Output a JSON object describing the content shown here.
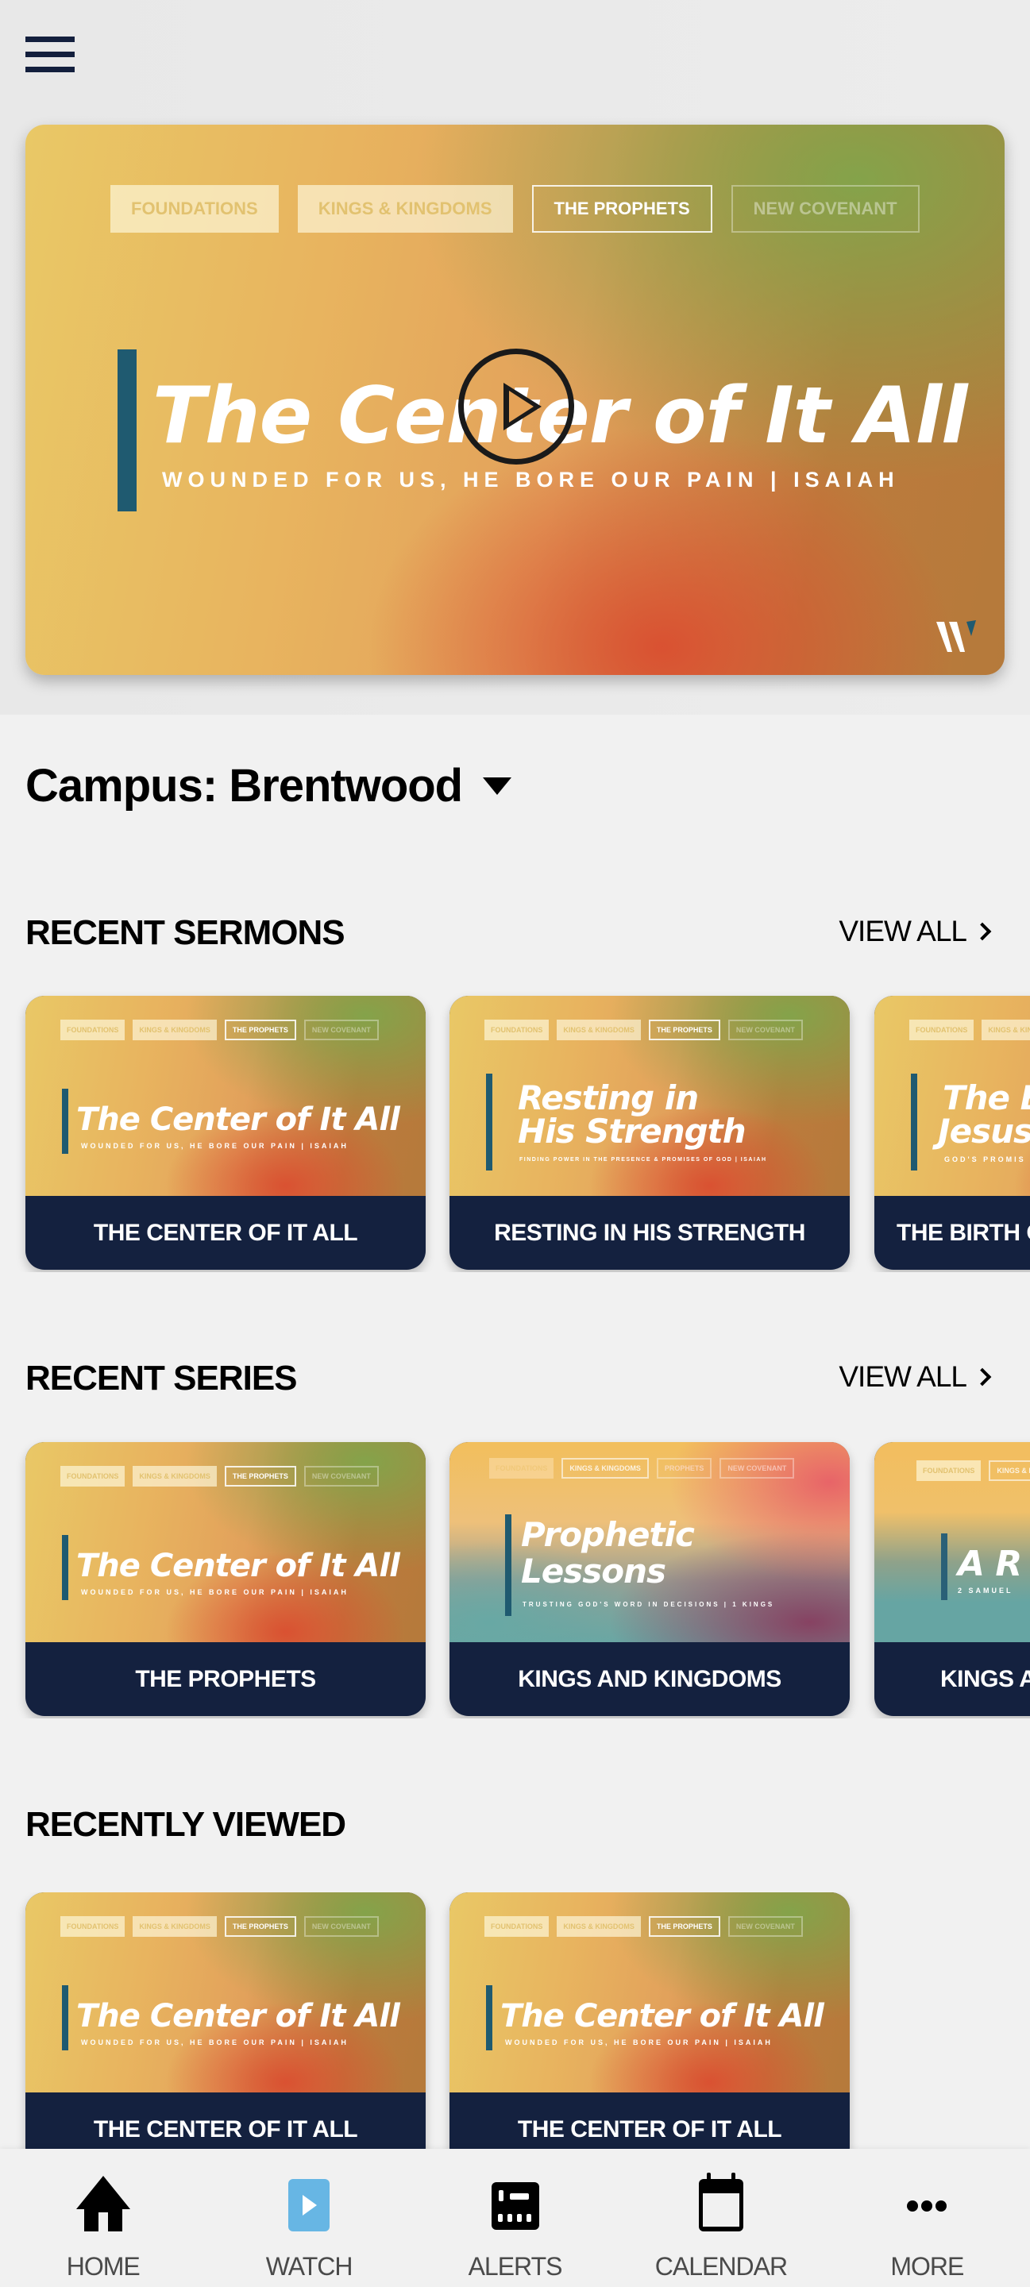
{
  "header": {
    "menu_icon": "hamburger-menu-icon"
  },
  "hero": {
    "tags": [
      "FOUNDATIONS",
      "KINGS & KINGDOMS",
      "THE PROPHETS",
      "NEW COVENANT"
    ],
    "title": "The Center of It All",
    "subtitle": "WOUNDED FOR US, HE BORE OUR PAIN | ISAIAH",
    "play_icon": "play-circle-icon",
    "logo": "W"
  },
  "campus": {
    "label": "Campus: Brentwood"
  },
  "sections": {
    "recent_sermons": {
      "title": "RECENT SERMONS",
      "view_all": "VIEW ALL",
      "items": [
        {
          "art_title": "The Center of It All",
          "art_sub": "WOUNDED FOR US, HE BORE OUR PAIN | ISAIAH",
          "caption": "THE CENTER OF IT ALL"
        },
        {
          "art_title_1": "Resting in",
          "art_title_2": "His Strength",
          "art_sub": "FINDING POWER IN THE PRESENCE & PROMISES OF GOD | ISAIAH",
          "caption": "RESTING IN HIS STRENGTH"
        },
        {
          "art_title_1": "The B",
          "art_title_2": "Jesus",
          "art_sub": "GOD'S PROMIS",
          "caption": "THE BIRTH O"
        }
      ]
    },
    "recent_series": {
      "title": "RECENT SERIES",
      "view_all": "VIEW ALL",
      "items": [
        {
          "art_title": "The Center of It All",
          "art_sub": "WOUNDED FOR US, HE BORE OUR PAIN | ISAIAH",
          "caption": "THE PROPHETS"
        },
        {
          "art_title_1": "Prophetic",
          "art_title_2": "Lessons",
          "art_sub": "TRUSTING GOD'S WORD IN DECISIONS | 1 KINGS",
          "caption": "KINGS AND KINGDOMS",
          "tags": [
            "FOUNDATIONS",
            "KINGS & KINGDOMS",
            "PROPHETS",
            "NEW COVENANT"
          ]
        },
        {
          "art_title": "A R",
          "art_sub": "2 SAMUEL",
          "caption": "KINGS A"
        }
      ]
    },
    "recently_viewed": {
      "title": "RECENTLY VIEWED",
      "items": [
        {
          "art_title": "The Center of It All",
          "art_sub": "WOUNDED FOR US, HE BORE OUR PAIN | ISAIAH",
          "caption": "THE CENTER OF IT ALL"
        },
        {
          "art_title": "The Center of It All",
          "art_sub": "WOUNDED FOR US, HE BORE OUR PAIN | ISAIAH",
          "caption": "THE CENTER OF IT ALL"
        }
      ]
    }
  },
  "card_tags": [
    "FOUNDATIONS",
    "KINGS & KINGDOMS",
    "THE PROPHETS",
    "NEW COVENANT"
  ],
  "bottom_nav": [
    {
      "label": "HOME",
      "icon": "home-icon"
    },
    {
      "label": "WATCH",
      "icon": "watch-play-icon",
      "active": true
    },
    {
      "label": "ALERTS",
      "icon": "alerts-icon"
    },
    {
      "label": "CALENDAR",
      "icon": "calendar-icon"
    },
    {
      "label": "MORE",
      "icon": "more-dots-icon"
    }
  ],
  "colors": {
    "navy": "#14213f",
    "accent_blue": "#67b6e4",
    "background": "#f1f1f1",
    "bar_teal": "#1f5a70"
  }
}
